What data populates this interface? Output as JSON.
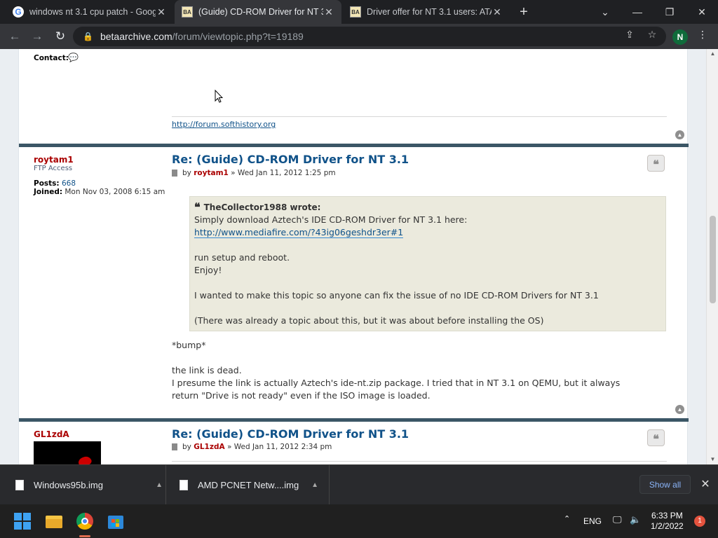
{
  "browser": {
    "tabs": [
      {
        "title": "windows nt 3.1 cpu patch - Goog",
        "favicon": "google-icon",
        "active": false
      },
      {
        "title": "(Guide) CD-ROM Driver for NT 3.",
        "favicon": "betaarchive-icon",
        "active": true
      },
      {
        "title": "Driver offer for NT 3.1 users: ATA",
        "favicon": "betaarchive-icon",
        "active": false
      }
    ],
    "favicon_letters": {
      "google": "G",
      "betaarchive": "BA"
    },
    "new_tab": "+",
    "url_host": "betaarchive.com",
    "url_path": "/forum/viewtopic.php?t=19189",
    "profile_initial": "N"
  },
  "forum": {
    "prev_post": {
      "contact_label": "Contact:",
      "signature_link": "http://forum.softhistory.org"
    },
    "posts": [
      {
        "author": "roytam1",
        "rank": "FTP Access",
        "posts_label": "Posts:",
        "posts_count": "668",
        "joined_label": "Joined:",
        "joined_date": "Mon Nov 03, 2008 6:15 am",
        "title": "Re: (Guide) CD-ROM Driver for NT 3.1",
        "by_prefix": "by",
        "by_user": "roytam1",
        "date": "» Wed Jan 11, 2012 1:25 pm",
        "quote": {
          "author_wrote": "TheCollector1988 wrote:",
          "line1": "Simply download Aztech's IDE CD-ROM Driver for NT 3.1 here:",
          "link": "http://www.mediafire.com/?43ig06geshdr3er#1",
          "line2": "run setup and reboot.",
          "line3": "Enjoy!",
          "line4": "I wanted to make this topic so anyone can fix the issue of no IDE CD-ROM Drivers for NT 3.1",
          "line5": "(There was already a topic about this, but it was about before installing the OS)"
        },
        "body": {
          "line1": "*bump*",
          "line2": "the link is dead.",
          "line3": "I presume the link is actually Aztech's ide-nt.zip package. I tried that in NT 3.1 on QEMU, but it always",
          "line4": "return \"Drive is not ready\" even if the ISO image is loaded."
        }
      },
      {
        "author": "GL1zdA",
        "title": "Re: (Guide) CD-ROM Driver for NT 3.1",
        "by_prefix": "by",
        "by_user": "GL1zdA",
        "date": "» Wed Jan 11, 2012 2:34 pm"
      }
    ]
  },
  "downloads": {
    "items": [
      {
        "name": "Windows95b.img"
      },
      {
        "name": "AMD PCNET Netw....img"
      }
    ],
    "show_all": "Show all"
  },
  "taskbar": {
    "language": "ENG",
    "time": "6:33 PM",
    "date": "1/2/2022",
    "notification_count": "1"
  }
}
